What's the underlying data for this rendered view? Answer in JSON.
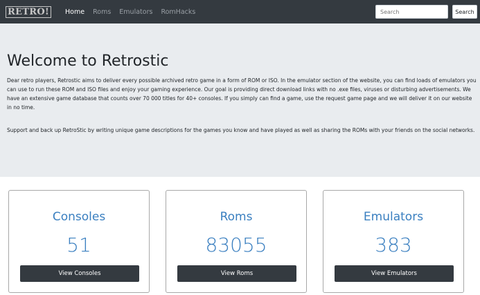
{
  "header": {
    "brand": "RETRO!",
    "nav": [
      "Home",
      "Roms",
      "Emulators",
      "RomHacks"
    ],
    "search_placeholder": "Search",
    "search_button": "Search"
  },
  "jumbotron": {
    "title": "Welcome to Retrostic",
    "paragraph1": "Dear retro players, Retrostic aims to deliver every possible archived retro game in a form of ROM or ISO. In the emulator section of the website, you can find loads of emulators you can use to run these ROM and ISO files and enjoy your gaming experience. Our goal is providing direct download links with no .exe files, viruses or disturbing advertisements. We have an extensive game database that counts over 70 000 titles for 40+ consoles. If you simply can find a game, use the request game page and we will deliver it on our website in no time.",
    "paragraph2": "Support and back up RetroStic by writing unique game descriptions for the games you know and have played as well as sharing the ROMs with your friends on the social networks."
  },
  "cards": [
    {
      "title": "Consoles",
      "count": "51",
      "button": "View Consoles"
    },
    {
      "title": "Roms",
      "count": "83055",
      "button": "View Roms"
    },
    {
      "title": "Emulators",
      "count": "383",
      "button": "View Emulators"
    }
  ],
  "colors": {
    "navbar": "#343a40",
    "jumbotron": "#e9ecef",
    "accent": "#3a7fc0"
  }
}
